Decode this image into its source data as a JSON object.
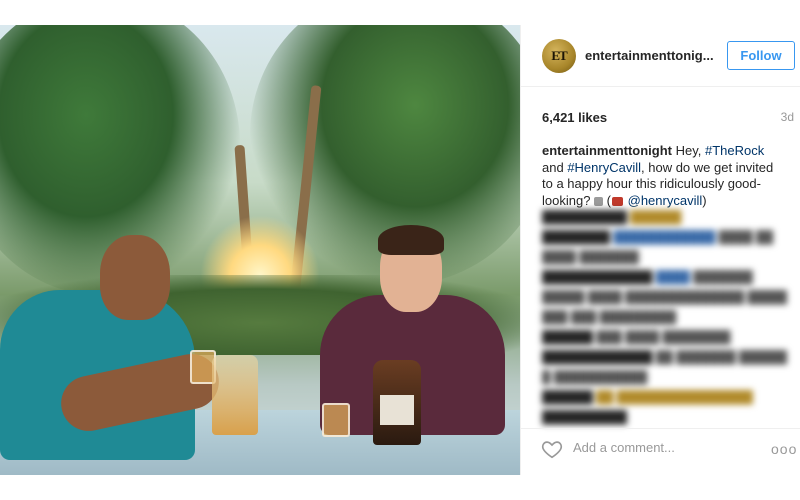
{
  "post": {
    "username": "entertainmenttonig...",
    "avatar_text": "ET",
    "follow_label": "Follow",
    "likes": "6,421 likes",
    "age": "3d",
    "caption": {
      "user": "entertainmenttonight",
      "p1": " Hey, ",
      "tag1": "#TheRock",
      "p2": " and ",
      "tag2": "#HenryCavill",
      "p3": ", how do we get invited to a happy hour this ridiculously good-looking? ",
      "p4": " (",
      "mention": "@henrycavill",
      "p5": ")"
    },
    "comment_placeholder": "Add a comment...",
    "more_glyph": "ooo",
    "blurred_comments": [
      "",
      "",
      "",
      "",
      "",
      "",
      "",
      "",
      "",
      "",
      ""
    ]
  },
  "colors": {
    "accent": "#3897f0",
    "hashtag": "#003569"
  },
  "icons": {
    "heart": "heart-icon",
    "more": "more-options-icon"
  }
}
